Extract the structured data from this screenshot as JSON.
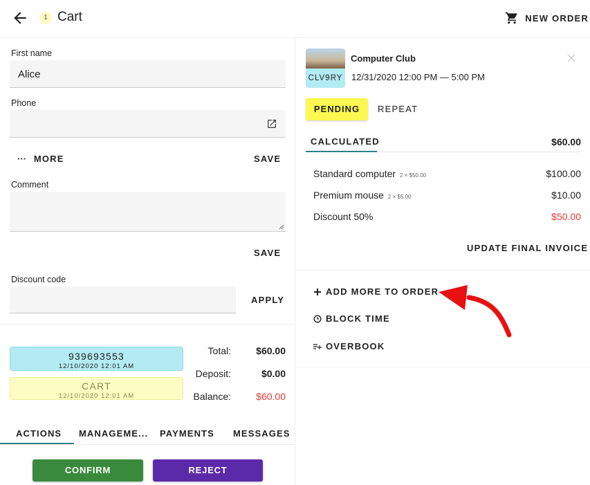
{
  "header": {
    "title": "Cart",
    "badge": "1",
    "new_order": "NEW ORDER"
  },
  "form": {
    "first_name_label": "First name",
    "first_name_value": "Alice",
    "phone_label": "Phone",
    "phone_value": "",
    "more_label": "MORE",
    "save_label": "SAVE",
    "comment_label": "Comment",
    "comment_value": "",
    "comment_save_label": "SAVE",
    "discount_label": "Discount code",
    "discount_value": "",
    "apply_label": "APPLY"
  },
  "chips": {
    "order_number": "939693553",
    "order_time": "12/10/2020 12:01 AM",
    "status": "CART",
    "status_time": "12/10/2020 12:01 AM"
  },
  "totals": {
    "total_label": "Total:",
    "total_value": "$60.00",
    "deposit_label": "Deposit:",
    "deposit_value": "$0.00",
    "balance_label": "Balance:",
    "balance_value": "$60.00"
  },
  "tabs": [
    "ACTIONS",
    "MANAGEME...",
    "PAYMENTS",
    "MESSAGES"
  ],
  "buttons": {
    "confirm": "CONFIRM",
    "reject": "REJECT"
  },
  "booking": {
    "venue": "Computer Club",
    "code": "CLV9RY",
    "time": "12/31/2020 12:00 PM — 5:00 PM",
    "status": "PENDING",
    "repeat": "REPEAT",
    "calc_label": "CALCULATED",
    "calc_total": "$60.00",
    "items": [
      {
        "name": "Standard computer",
        "detail": "2 × $50.00",
        "amount": "$100.00"
      },
      {
        "name": "Premium mouse",
        "detail": "2 × $5.00",
        "amount": "$10.00"
      },
      {
        "name": "Discount 50%",
        "detail": "",
        "amount": "$50.00"
      }
    ],
    "update_invoice": "UPDATE FINAL INVOICE"
  },
  "actions": {
    "add_more": "ADD MORE TO ORDER",
    "block_time": "BLOCK TIME",
    "overbook": "OVERBOOK"
  },
  "colors": {
    "accent": "#2f7f86",
    "confirm": "#3a8a3e",
    "reject": "#5b2aa8",
    "negative": "#e53935",
    "pending": "#fdf751",
    "annotation_arrow": "#e81010"
  }
}
